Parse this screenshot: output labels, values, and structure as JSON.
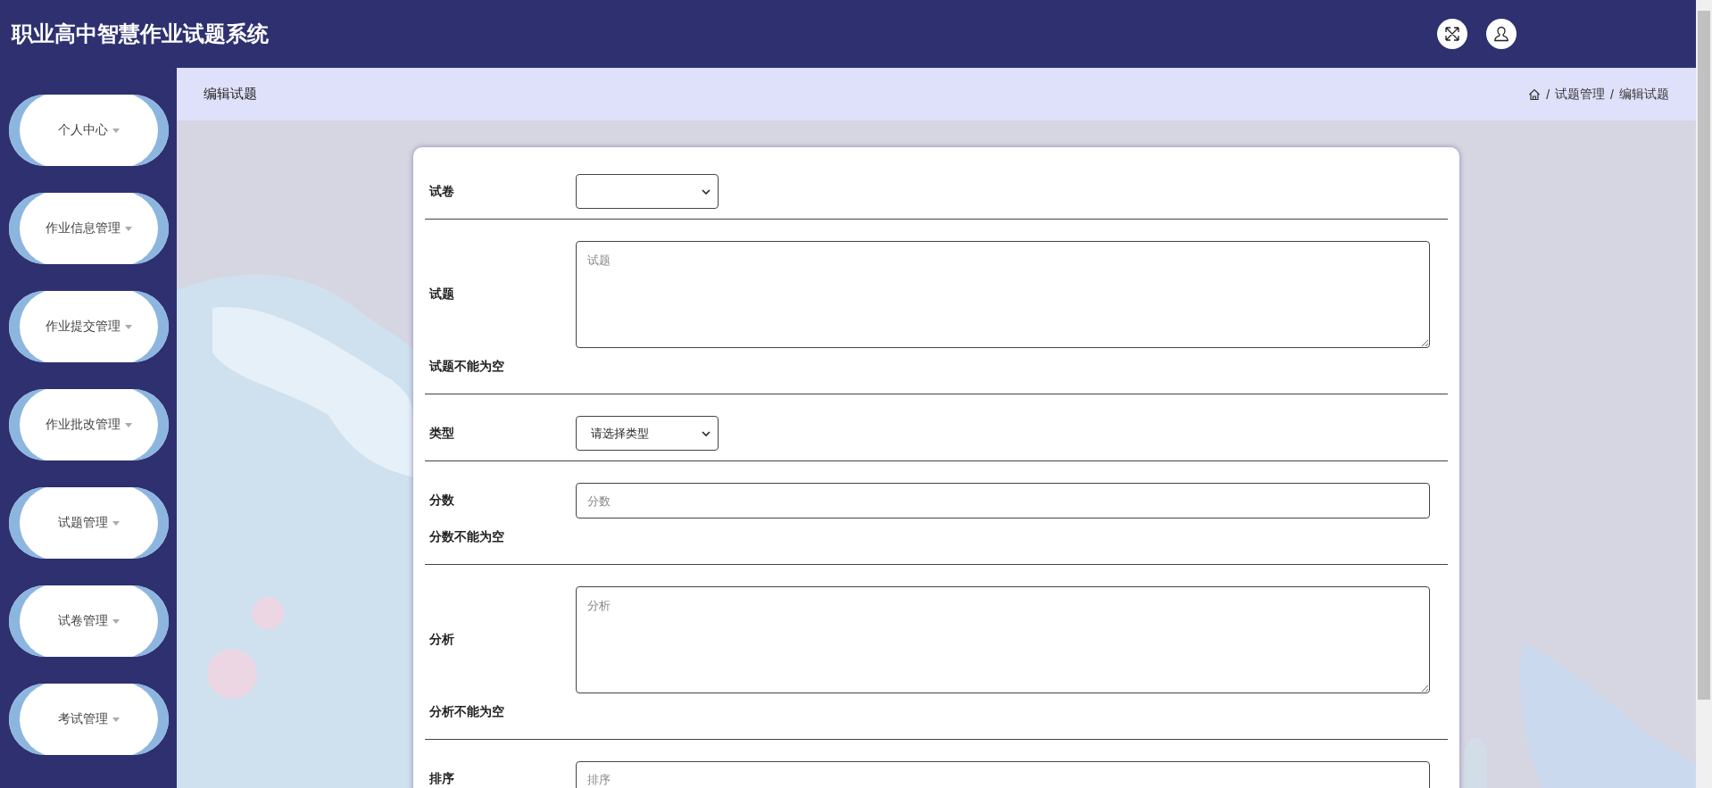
{
  "header": {
    "title": "职业高中智慧作业试题系统"
  },
  "sidebar": {
    "items": [
      {
        "label": "个人中心"
      },
      {
        "label": "作业信息管理"
      },
      {
        "label": "作业提交管理"
      },
      {
        "label": "作业批改管理"
      },
      {
        "label": "试题管理"
      },
      {
        "label": "试卷管理"
      },
      {
        "label": "考试管理"
      }
    ]
  },
  "page": {
    "title": "编辑试题",
    "breadcrumb": [
      {
        "separator": "/",
        "label": "试题管理"
      },
      {
        "separator": "/",
        "label": "编辑试题"
      }
    ]
  },
  "form": {
    "fields": [
      {
        "kind": "select",
        "label": "试卷"
      },
      {
        "kind": "textarea",
        "label": "试题",
        "placeholder": "试题",
        "error": "试题不能为空"
      },
      {
        "kind": "select",
        "label": "类型",
        "value": "请选择类型"
      },
      {
        "kind": "input",
        "label": "分数",
        "placeholder": "分数",
        "error": "分数不能为空"
      },
      {
        "kind": "textarea",
        "label": "分析",
        "placeholder": "分析",
        "error": "分析不能为空"
      },
      {
        "kind": "input",
        "label": "排序",
        "placeholder": "排序"
      }
    ]
  }
}
